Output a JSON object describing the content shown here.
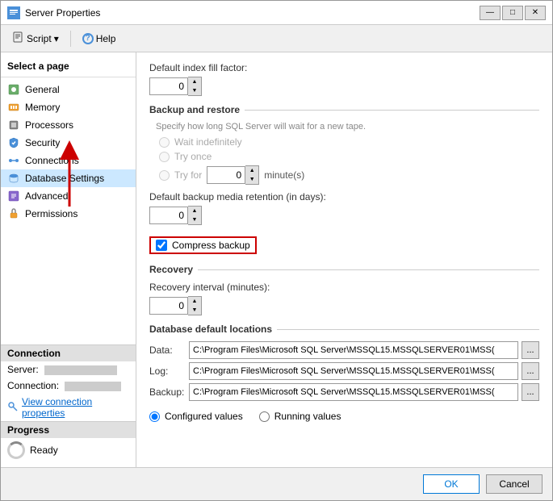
{
  "window": {
    "title": "Server Properties",
    "titlebar_buttons": [
      "—",
      "□",
      "✕"
    ]
  },
  "toolbar": {
    "script_label": "Script",
    "help_label": "Help"
  },
  "sidebar": {
    "header": "Select a page",
    "items": [
      {
        "label": "General",
        "icon": "general-icon"
      },
      {
        "label": "Memory",
        "icon": "memory-icon"
      },
      {
        "label": "Processors",
        "icon": "processors-icon"
      },
      {
        "label": "Security",
        "icon": "security-icon"
      },
      {
        "label": "Connections",
        "icon": "connections-icon"
      },
      {
        "label": "Database Settings",
        "icon": "database-settings-icon"
      },
      {
        "label": "Advanced",
        "icon": "advanced-icon"
      },
      {
        "label": "Permissions",
        "icon": "permissions-icon"
      }
    ],
    "connection_section": "Connection",
    "server_label": "Server:",
    "connection_label": "Connection:",
    "view_conn_label": "View connection properties",
    "progress_section": "Progress",
    "progress_status": "Ready"
  },
  "content": {
    "index_fill_label": "Default index fill factor:",
    "index_fill_value": "0",
    "backup_restore_section": "Backup and restore",
    "backup_hint": "Specify how long SQL Server will wait for a new tape.",
    "wait_indefinitely": "Wait indefinitely",
    "try_once": "Try once",
    "try_for": "Try for",
    "try_for_value": "0",
    "minutes_label": "minute(s)",
    "media_retention_label": "Default backup media retention (in days):",
    "media_retention_value": "0",
    "compress_backup_label": "Compress backup",
    "recovery_section": "Recovery",
    "recovery_interval_label": "Recovery interval (minutes):",
    "recovery_interval_value": "0",
    "db_locations_section": "Database default locations",
    "data_label": "Data:",
    "data_path": "C:\\Program Files\\Microsoft SQL Server\\MSSQL15.MSSQLSERVER01\\MSS(",
    "log_label": "Log:",
    "log_path": "C:\\Program Files\\Microsoft SQL Server\\MSSQL15.MSSQLSERVER01\\MSS(",
    "backup_label": "Backup:",
    "backup_path": "C:\\Program Files\\Microsoft SQL Server\\MSSQL15.MSSQLSERVER01\\MSS(",
    "configured_values": "Configured values",
    "running_values": "Running values"
  },
  "footer": {
    "ok_label": "OK",
    "cancel_label": "Cancel"
  }
}
